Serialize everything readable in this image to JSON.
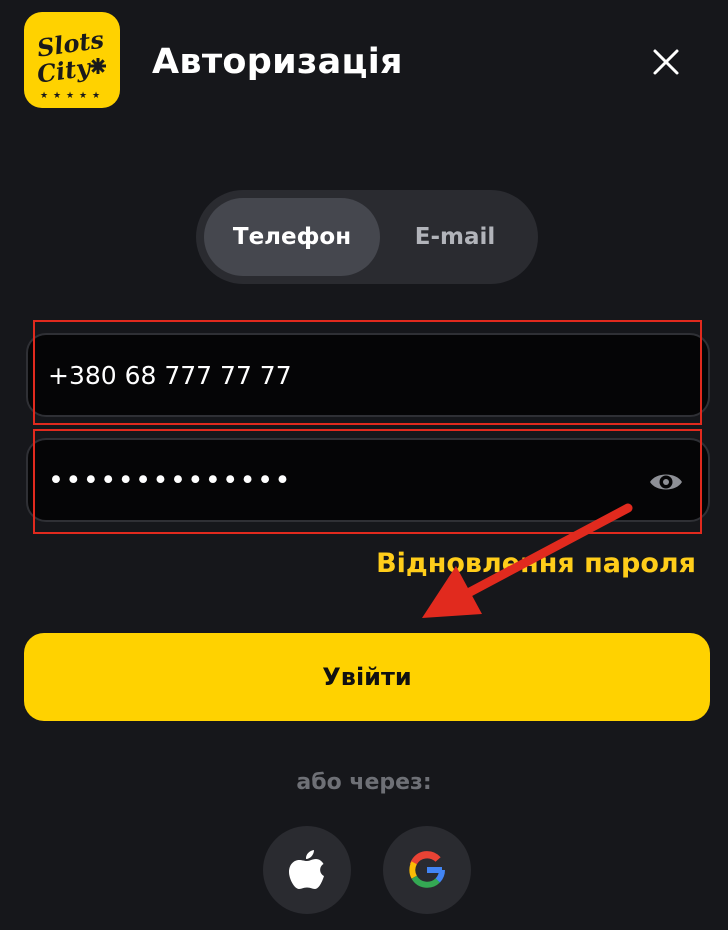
{
  "header": {
    "logo_text_line1": "Slots",
    "logo_text_line2": "City",
    "title": "Авторизація",
    "close_icon": "close-icon"
  },
  "tabs": [
    {
      "label": "Телефон",
      "active": true
    },
    {
      "label": "E-mail",
      "active": false
    }
  ],
  "form": {
    "phone_value": "+380 68 777 77 77",
    "password_value": "••••••••••••••",
    "password_toggle_icon": "eye-icon",
    "recover_label": "Відновлення пароля",
    "submit_label": "Увійти"
  },
  "social": {
    "divider_label": "або через:",
    "providers": [
      {
        "name": "apple",
        "icon": "apple-icon"
      },
      {
        "name": "google",
        "icon": "google-icon"
      }
    ]
  },
  "colors": {
    "background": "#16171b",
    "accent": "#ffd200",
    "link": "#ffcd1a",
    "annotation": "#e12a1e"
  }
}
